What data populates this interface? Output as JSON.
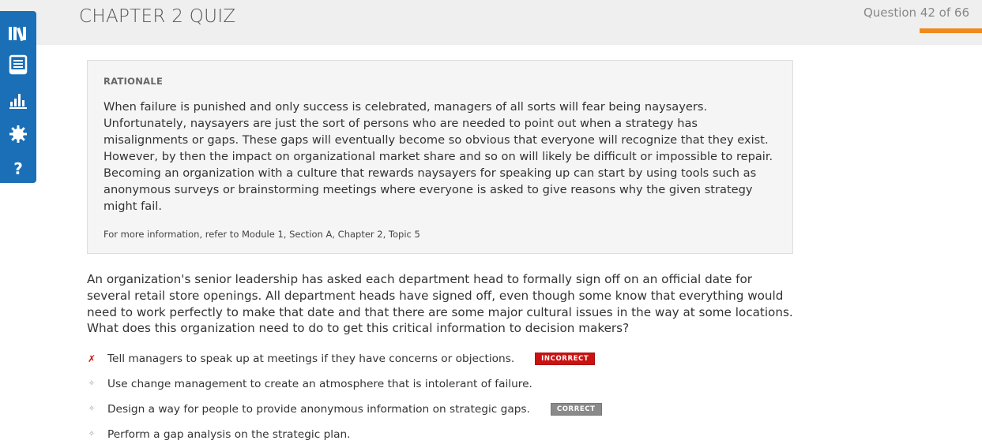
{
  "header": {
    "title": "CHAPTER 2 QUIZ",
    "question_counter": "Question 42 of 66",
    "progress_fraction": 0.636
  },
  "sidebar": {
    "items": [
      {
        "icon": "library-icon"
      },
      {
        "icon": "notebook-icon"
      },
      {
        "icon": "bar-chart-icon"
      },
      {
        "icon": "gear-icon"
      },
      {
        "icon": "help-icon",
        "label": "?"
      }
    ]
  },
  "rationale": {
    "label": "RATIONALE",
    "text": "When failure is punished and only success is celebrated, managers of all sorts will fear being naysayers. Unfortunately, naysayers are just the sort of persons who are needed to point out when a strategy has misalignments or gaps. These gaps will eventually become so obvious that everyone will recognize that they exist. However, by then the impact on organizational market share and so on will likely be difficult or impossible to repair. Becoming an organization with a culture that rewards naysayers for speaking up can start by using tools such as anonymous surveys or brainstorming meetings where everyone is asked to give reasons why the given strategy might fail.",
    "reference": "For more information, refer to Module 1, Section A, Chapter 2, Topic 5"
  },
  "question": {
    "text": "An organization's senior leadership has asked each department head to formally sign off on an official date for several retail store openings. All department heads have signed off, even though some know that everything would need to work perfectly to make that date and that there are some major cultural issues in the way at some locations. What does this organization need to do to get this critical information to decision makers?"
  },
  "answers": [
    {
      "marker": "✗",
      "text": "Tell managers to speak up at meetings if they have concerns or objections.",
      "badge": "INCORRECT"
    },
    {
      "marker": "✧",
      "text": "Use change management to create an atmosphere that is intolerant of failure.",
      "badge": ""
    },
    {
      "marker": "✧",
      "text": "Design a way for people to provide anonymous information on strategic gaps.",
      "badge": "CORRECT"
    },
    {
      "marker": "✧",
      "text": "Perform a gap analysis on the strategic plan.",
      "badge": ""
    }
  ],
  "colors": {
    "accent": "#1a6fb7",
    "progress": "#f08a1c",
    "incorrect": "#cc1111",
    "correct_badge": "#8a8a8a"
  }
}
